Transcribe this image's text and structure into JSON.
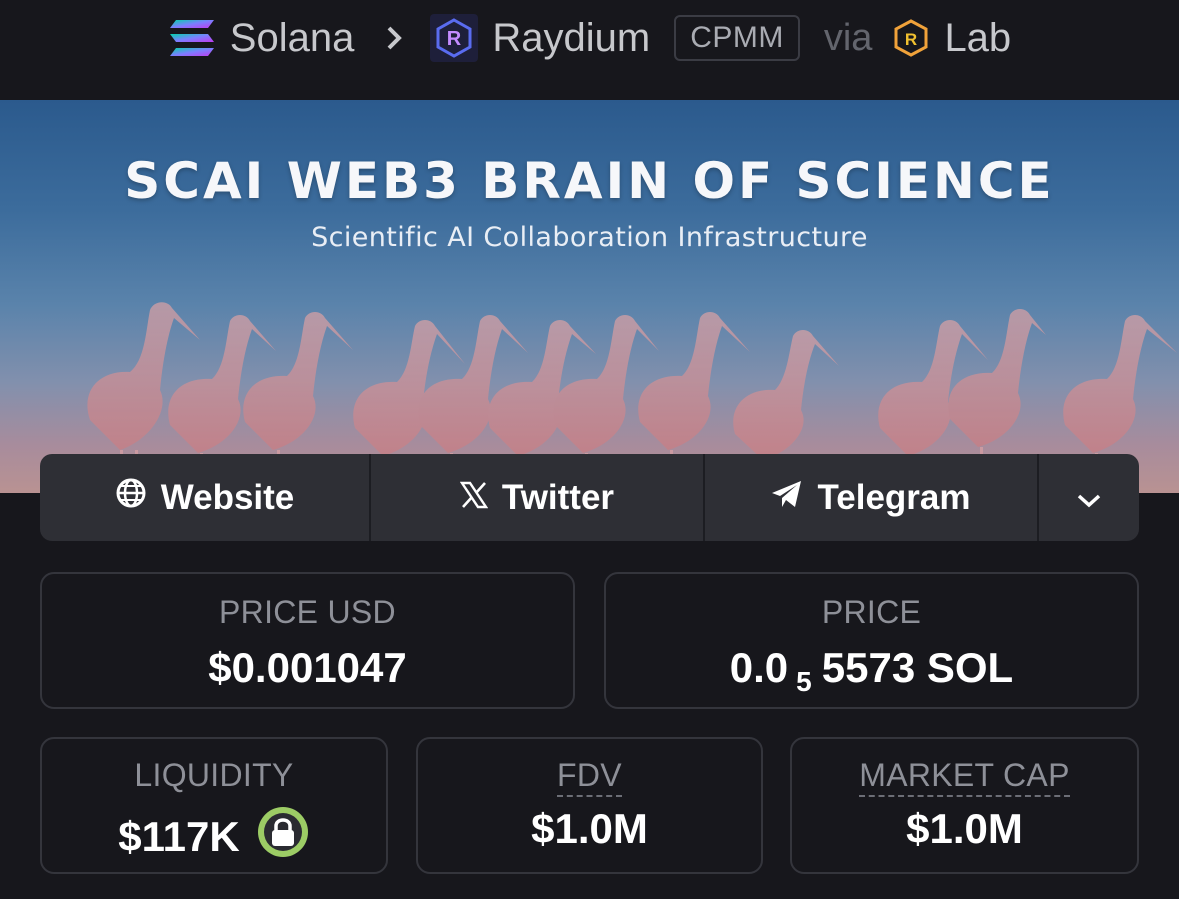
{
  "breadcrumb": {
    "chain": "Solana",
    "separator": ">",
    "dex": "Raydium",
    "pool_type": "CPMM",
    "via": "via",
    "launchpad": "Lab",
    "icons": {
      "chain": "solana-logo-icon",
      "dex": "raydium-logo-icon",
      "launchpad": "raydium-lab-icon",
      "separator": "chevron-right-icon"
    }
  },
  "banner": {
    "title": "SCAI WEB3 BRAIN OF SCIENCE",
    "subtitle": "Scientific AI Collaboration Infrastructure"
  },
  "links": [
    {
      "label": "Website",
      "icon": "globe-icon"
    },
    {
      "label": "Twitter",
      "icon": "x-logo-icon"
    },
    {
      "label": "Telegram",
      "icon": "telegram-icon"
    },
    {
      "label": "",
      "icon": "chevron-down-icon"
    }
  ],
  "stats": {
    "price_usd": {
      "label": "PRICE USD",
      "value": "$0.001047"
    },
    "price": {
      "label": "PRICE",
      "prefix": "0.0",
      "zeros": "5",
      "suffix": "5573 SOL"
    },
    "liquidity": {
      "label": "LIQUIDITY",
      "value": "$117K",
      "icon": "lock-icon"
    },
    "fdv": {
      "label": "FDV",
      "value": "$1.0M"
    },
    "market_cap": {
      "label": "MARKET CAP",
      "value": "$1.0M"
    }
  },
  "colors": {
    "background": "#17171c",
    "card_border": "#34353c",
    "link_bar": "#2e2f35",
    "label_text": "#8e9098",
    "lock_ring": "#9ccc65"
  }
}
